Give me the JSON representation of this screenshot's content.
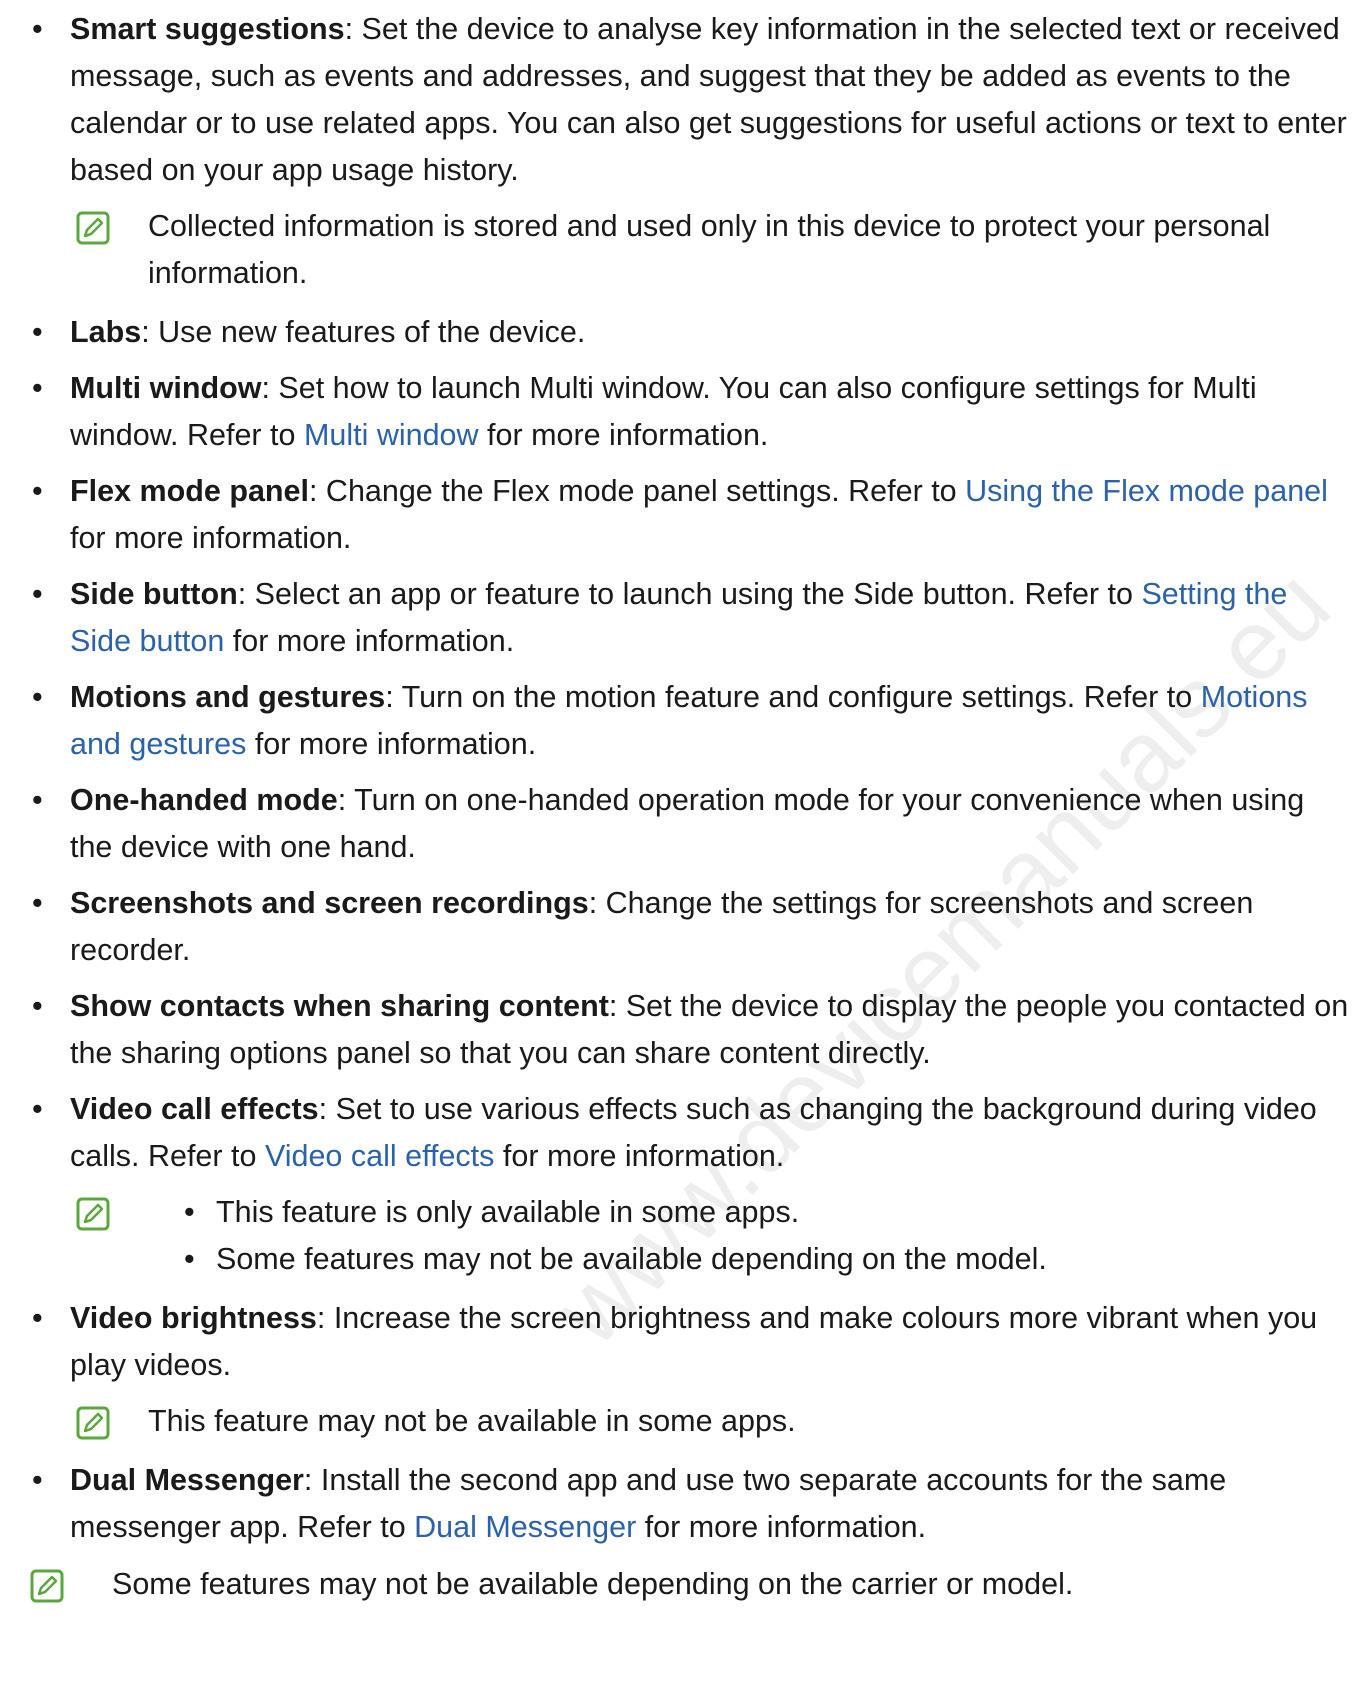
{
  "watermark": "www.devicemanuals.eu",
  "items": {
    "smart": {
      "term": "Smart suggestions",
      "text": ": Set the device to analyse key information in the selected text or received message, such as events and addresses, and suggest that they be added as events to the calendar or to use related apps. You can also get suggestions for useful actions or text to enter based on your app usage history.",
      "note": "Collected information is stored and used only in this device to protect your personal information."
    },
    "labs": {
      "term": "Labs",
      "text": ": Use new features of the device."
    },
    "multi": {
      "term": "Multi window",
      "text1": ": Set how to launch Multi window. You can also configure settings for Multi window. Refer to ",
      "link": "Multi window",
      "text2": " for more information."
    },
    "flex": {
      "term": "Flex mode panel",
      "text1": ": Change the Flex mode panel settings. Refer to ",
      "link": "Using the Flex mode panel",
      "text2": " for more information."
    },
    "side": {
      "term": "Side button",
      "text1": ": Select an app or feature to launch using the Side button. Refer to ",
      "link": "Setting the Side button",
      "text2": " for more information."
    },
    "motions": {
      "term": "Motions and gestures",
      "text1": ": Turn on the motion feature and configure settings. Refer to ",
      "link": "Motions and gestures",
      "text2": " for more information."
    },
    "onehand": {
      "term": "One-handed mode",
      "text": ": Turn on one-handed operation mode for your convenience when using the device with one hand."
    },
    "screenshots": {
      "term": "Screenshots and screen recordings",
      "text": ": Change the settings for screenshots and screen recorder."
    },
    "contacts": {
      "term": "Show contacts when sharing content",
      "text": ": Set the device to display the people you contacted on the sharing options panel so that you can share content directly."
    },
    "videocall": {
      "term": "Video call effects",
      "text1": ": Set to use various effects such as changing the background during video calls. Refer to ",
      "link": "Video call effects",
      "text2": " for more information.",
      "notes": [
        "This feature is only available in some apps.",
        "Some features may not be available depending on the model."
      ]
    },
    "brightness": {
      "term": "Video brightness",
      "text": ": Increase the screen brightness and make colours more vibrant when you play videos.",
      "note": "This feature may not be available in some apps."
    },
    "dual": {
      "term": "Dual Messenger",
      "text1": ": Install the second app and use two separate accounts for the same messenger app. Refer to ",
      "link": "Dual Messenger",
      "text2": " for more information."
    }
  },
  "final_note": "Some features may not be available depending on the carrier or model.",
  "bullet": "•",
  "icon_color": "#5aa83c",
  "link_color": "#2a62ad"
}
